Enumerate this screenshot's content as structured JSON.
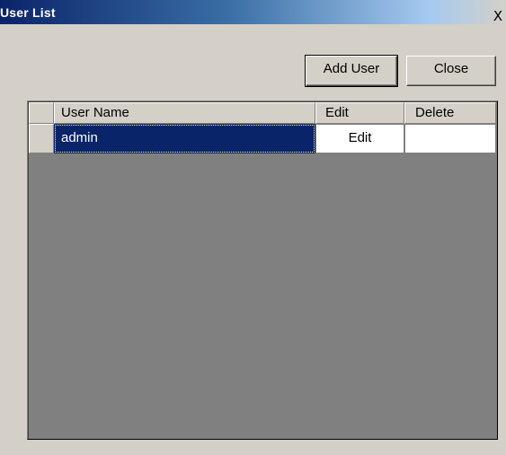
{
  "window": {
    "title": "User List",
    "close_glyph": "X"
  },
  "toolbar": {
    "add_user_label": "Add User",
    "close_label": "Close"
  },
  "grid": {
    "columns": [
      "User Name",
      "Edit",
      "Delete"
    ],
    "rows": [
      {
        "user_name": "admin",
        "edit_label": "Edit",
        "delete_label": "",
        "selected": true
      }
    ]
  },
  "colors": {
    "titlebar_start": "#0a246a",
    "titlebar_end": "#a6caf0",
    "selection_bg": "#0a246a",
    "dialog_bg": "#d4d0c8",
    "grid_empty_bg": "#808080"
  },
  "icons": {
    "close": "close-icon"
  }
}
